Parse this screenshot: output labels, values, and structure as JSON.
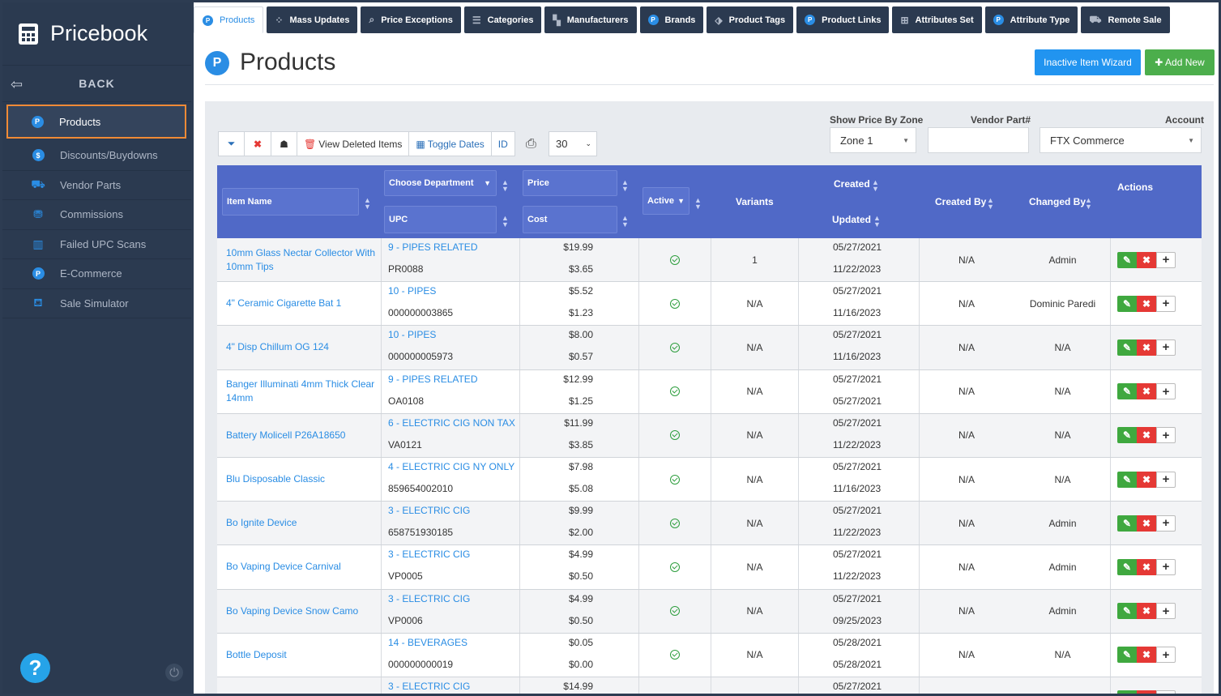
{
  "app": {
    "title": "Pricebook",
    "back_label": "BACK"
  },
  "sidebar": {
    "items": [
      {
        "label": "Products",
        "icon": "p-badge-icon",
        "active": true
      },
      {
        "label": "Discounts/Buydowns",
        "icon": "dollar-badge-icon"
      },
      {
        "label": "Vendor Parts",
        "icon": "forklift-icon"
      },
      {
        "label": "Commissions",
        "icon": "money-bag-icon"
      },
      {
        "label": "Failed UPC Scans",
        "icon": "barcode-icon"
      },
      {
        "label": "E-Commerce",
        "icon": "p-badge-icon"
      },
      {
        "label": "Sale Simulator",
        "icon": "basket-icon"
      }
    ],
    "help_symbol": "?",
    "power_symbol": "⏻"
  },
  "tabs": [
    {
      "label": "Products",
      "icon": "p-badge-icon",
      "active": true
    },
    {
      "label": "Mass Updates",
      "icon": "spinner-icon"
    },
    {
      "label": "Price Exceptions",
      "icon": "search-dollar-icon"
    },
    {
      "label": "Categories",
      "icon": "list-icon"
    },
    {
      "label": "Manufacturers",
      "icon": "chart-icon"
    },
    {
      "label": "Brands",
      "icon": "p-badge-icon"
    },
    {
      "label": "Product Tags",
      "icon": "tags-icon"
    },
    {
      "label": "Product Links",
      "icon": "p-badge-icon"
    },
    {
      "label": "Attributes Set",
      "icon": "sitemap-icon"
    },
    {
      "label": "Attribute Type",
      "icon": "p-badge-icon"
    },
    {
      "label": "Remote Sale",
      "icon": "cart-icon"
    }
  ],
  "page": {
    "title": "Products",
    "inactive_wizard_label": "Inactive Item Wizard",
    "add_new_label": "Add New"
  },
  "filters": {
    "zone_label": "Show Price By Zone",
    "zone_value": "Zone 1",
    "vendor_part_label": "Vendor Part#",
    "vendor_part_value": "",
    "account_label": "Account",
    "account_value": "FTX Commerce"
  },
  "toolbar": {
    "view_deleted_label": "View Deleted Items",
    "toggle_dates_label": "Toggle Dates",
    "id_label": "ID",
    "page_size": "30"
  },
  "table": {
    "headers": {
      "item_name": "Item Name",
      "department": "Choose Department",
      "upc": "UPC",
      "price": "Price",
      "cost": "Cost",
      "active": "Active",
      "variants": "Variants",
      "created": "Created",
      "updated": "Updated",
      "created_by": "Created By",
      "changed_by": "Changed By",
      "actions": "Actions"
    },
    "rows": [
      {
        "name": "10mm Glass Nectar Collector With 10mm Tips",
        "dept": "9 - PIPES RELATED",
        "upc": "PR0088",
        "price": "$19.99",
        "cost": "$3.65",
        "variants": "1",
        "created": "05/27/2021",
        "updated": "11/22/2023",
        "created_by": "N/A",
        "changed_by": "Admin"
      },
      {
        "name": "4\" Ceramic Cigarette Bat 1",
        "dept": "10 - PIPES",
        "upc": "000000003865",
        "price": "$5.52",
        "cost": "$1.23",
        "variants": "N/A",
        "created": "05/27/2021",
        "updated": "11/16/2023",
        "created_by": "N/A",
        "changed_by": "Dominic Paredi"
      },
      {
        "name": "4\" Disp Chillum OG 124",
        "dept": "10 - PIPES",
        "upc": "000000005973",
        "price": "$8.00",
        "cost": "$0.57",
        "variants": "N/A",
        "created": "05/27/2021",
        "updated": "11/16/2023",
        "created_by": "N/A",
        "changed_by": "N/A"
      },
      {
        "name": "Banger Illuminati 4mm Thick Clear 14mm",
        "dept": "9 - PIPES RELATED",
        "upc": "OA0108",
        "price": "$12.99",
        "cost": "$1.25",
        "variants": "N/A",
        "created": "05/27/2021",
        "updated": "05/27/2021",
        "created_by": "N/A",
        "changed_by": "N/A"
      },
      {
        "name": "Battery Molicell P26A18650",
        "dept": "6 - ELECTRIC CIG NON TAX",
        "upc": "VA0121",
        "price": "$11.99",
        "cost": "$3.85",
        "variants": "N/A",
        "created": "05/27/2021",
        "updated": "11/22/2023",
        "created_by": "N/A",
        "changed_by": "N/A"
      },
      {
        "name": "Blu Disposable Classic",
        "dept": "4 - ELECTRIC CIG NY ONLY",
        "upc": "859654002010",
        "price": "$7.98",
        "cost": "$5.08",
        "variants": "N/A",
        "created": "05/27/2021",
        "updated": "11/16/2023",
        "created_by": "N/A",
        "changed_by": "N/A"
      },
      {
        "name": "Bo Ignite Device",
        "dept": "3 - ELECTRIC CIG",
        "upc": "658751930185",
        "price": "$9.99",
        "cost": "$2.00",
        "variants": "N/A",
        "created": "05/27/2021",
        "updated": "11/22/2023",
        "created_by": "N/A",
        "changed_by": "Admin"
      },
      {
        "name": "Bo Vaping Device Carnival",
        "dept": "3 - ELECTRIC CIG",
        "upc": "VP0005",
        "price": "$4.99",
        "cost": "$0.50",
        "variants": "N/A",
        "created": "05/27/2021",
        "updated": "11/22/2023",
        "created_by": "N/A",
        "changed_by": "Admin"
      },
      {
        "name": "Bo Vaping Device Snow Camo",
        "dept": "3 - ELECTRIC CIG",
        "upc": "VP0006",
        "price": "$4.99",
        "cost": "$0.50",
        "variants": "N/A",
        "created": "05/27/2021",
        "updated": "09/25/2023",
        "created_by": "N/A",
        "changed_by": "Admin"
      },
      {
        "name": "Bottle Deposit",
        "dept": "14 - BEVERAGES",
        "upc": "000000000019",
        "price": "$0.05",
        "cost": "$0.00",
        "variants": "N/A",
        "created": "05/28/2021",
        "updated": "05/28/2021",
        "created_by": "N/A",
        "changed_by": "N/A"
      },
      {
        "name": "",
        "dept": "3 - ELECTRIC CIG",
        "upc": "",
        "price": "$14.99",
        "cost": "",
        "variants": "",
        "created": "05/27/2021",
        "updated": "",
        "created_by": "",
        "changed_by": ""
      }
    ]
  },
  "colors": {
    "sidebar": "#2b3a50",
    "accent": "#2a8de4",
    "header": "#5069c7",
    "active_outline": "#f08a36",
    "add_button": "#4cae4c",
    "delete_button": "#e53935"
  }
}
